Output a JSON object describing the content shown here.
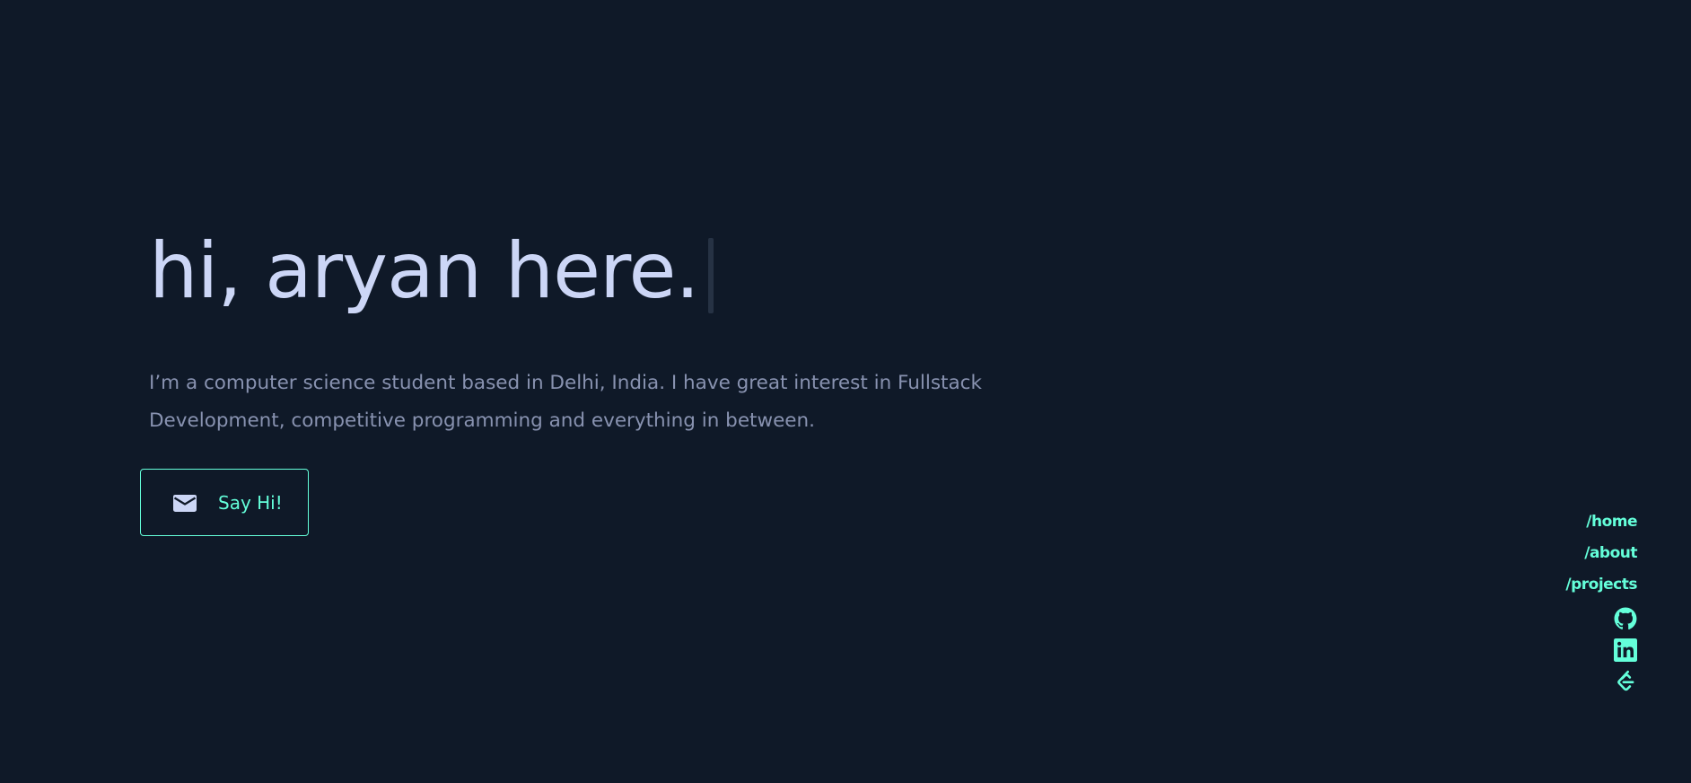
{
  "hero": {
    "title": "hi, aryan here.",
    "bio": "I’m a computer science student based in Delhi, India. I have great interest in Fullstack Development, competitive programming and everything in between."
  },
  "cta": {
    "label": "Say Hi!",
    "icon": "envelope-icon"
  },
  "side_nav": {
    "links": [
      {
        "label": "/home"
      },
      {
        "label": "/about"
      },
      {
        "label": "/projects"
      }
    ],
    "socials": [
      {
        "icon": "github-icon"
      },
      {
        "icon": "linkedin-icon"
      },
      {
        "icon": "leetcode-icon"
      }
    ]
  },
  "colors": {
    "background": "#0f1928",
    "heading": "#ccd6f6",
    "text": "#8892b0",
    "accent": "#64ffda"
  }
}
